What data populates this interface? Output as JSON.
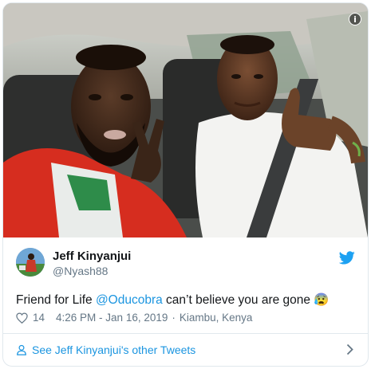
{
  "tweet": {
    "author_name": "Jeff Kinyanjui",
    "author_handle": "@Nyash88",
    "text_before": "Friend for Life ",
    "mention": "@Oducobra",
    "text_after": " can’t believe you are gone",
    "emoji": "😰",
    "likes": "14",
    "timestamp": "4:26 PM - Jan 16, 2019",
    "dot": "·",
    "location": "Kiambu, Kenya"
  },
  "footer": {
    "more_tweets_label": "See Jeff Kinyanjui's other Tweets"
  },
  "colors": {
    "link": "#1b95e0",
    "secondary_text": "#657786",
    "border": "#e1e8ed"
  },
  "icons": [
    "info-icon",
    "twitter-bird-icon",
    "heart-icon",
    "person-icon",
    "chevron-right-icon"
  ]
}
